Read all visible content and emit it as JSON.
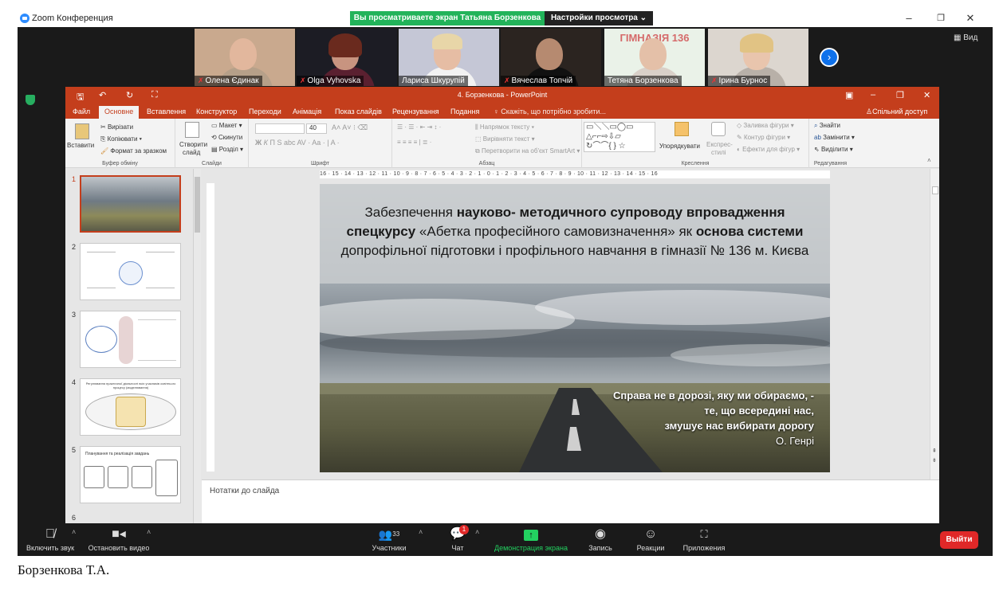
{
  "zoom": {
    "app_name": "Zoom Конференция",
    "share_banner": "Вы просматриваете экран Татьяна Борзенкова",
    "view_options": "Настройки просмотра ⌄",
    "view_label": "Вид",
    "participants": [
      {
        "name": "Олена Єдинак",
        "muted": true
      },
      {
        "name": "Olga  Vyhovska",
        "muted": true
      },
      {
        "name": "Лариса Шкурупій",
        "muted": false
      },
      {
        "name": "Вячеслав Топчій",
        "muted": true
      },
      {
        "name": "Тетяна Борзенкова",
        "muted": false
      },
      {
        "name": "Ірина Бурнос",
        "muted": true
      }
    ],
    "toolbar": {
      "audio": "Включить звук",
      "video": "Остановить видео",
      "participants": "Участники",
      "participants_count": "33",
      "chat": "Чат",
      "chat_badge": "1",
      "share": "Демонстрация экрана",
      "record": "Запись",
      "reactions": "Реакции",
      "apps": "Приложения",
      "leave": "Выйти"
    }
  },
  "ppt": {
    "title": "4. Борзенкова - PowerPoint",
    "tabs": [
      "Файл",
      "Основне",
      "Вставлення",
      "Конструктор",
      "Переходи",
      "Анімація",
      "Показ слайдів",
      "Рецензування",
      "Подання"
    ],
    "tell_me": "Скажіть, що потрібно зробити...",
    "share": "Спільний доступ",
    "ribbon": {
      "clipboard": {
        "paste": "Вставити",
        "cut": "Вирізати",
        "copy": "Копіювати",
        "format": "Формат за зразком",
        "label": "Буфер обміну"
      },
      "slides": {
        "new": "Створити",
        "new2": "слайд",
        "layout": "Макет",
        "reset": "Скинути",
        "section": "Розділ",
        "label": "Слайди"
      },
      "font": {
        "size": "40",
        "label": "Шрифт"
      },
      "paragraph": {
        "direction": "Напрямок тексту",
        "align": "Вирівняти текст",
        "smartart": "Перетворити на об'єкт SmartArt",
        "label": "Абзац"
      },
      "drawing": {
        "arrange": "Упорядкувати",
        "styles": "Експрес-",
        "styles2": "стилі",
        "fill": "Заливка фігури",
        "outline": "Контур фігури",
        "effects": "Ефекти для фігур",
        "label": "Креслення"
      },
      "editing": {
        "find": "Знайти",
        "replace": "Замінити",
        "select": "Виділити",
        "label": "Редагування"
      }
    },
    "thumb_numbers": [
      "1",
      "2",
      "3",
      "4",
      "5",
      "6"
    ],
    "thumb5_title": "Планування та реалізація завдань",
    "thumb4_title": "Регулювання практичної діяльності всіх учасників освітнього процесу (моделювання)",
    "hruler": "16 · 15 · 14 · 13 · 12 · 11 · 10 · 9 · 8 · 7 · 6 · 5 · 4 · 3 · 2 · 1 · 0 · 1 · 2 · 3 · 4 · 5 · 6 · 7 · 8 · 9 · 10 · 11 · 12 · 13 · 14 · 15 · 16",
    "slide": {
      "title_parts": [
        {
          "text": "Забезпечення ",
          "bold": false
        },
        {
          "text": "науково- методичного супроводу впровадження спецкурсу",
          "bold": true
        },
        {
          "text": " «Абетка професійного самовизначення» як ",
          "bold": false
        },
        {
          "text": "основа системи",
          "bold": true
        },
        {
          "text": " допрофільної підготовки і профільного навчання в гімназії № 136 м. Києва",
          "bold": false
        }
      ],
      "quote": [
        "Справа не в дорозі, яку ми обираємо, -",
        "те, що всередині нас,",
        "змушує нас вибирати дорогу",
        "О. Генрі"
      ]
    },
    "notes": "Нотатки до слайда"
  },
  "caption": "Борзенкова Т.А."
}
